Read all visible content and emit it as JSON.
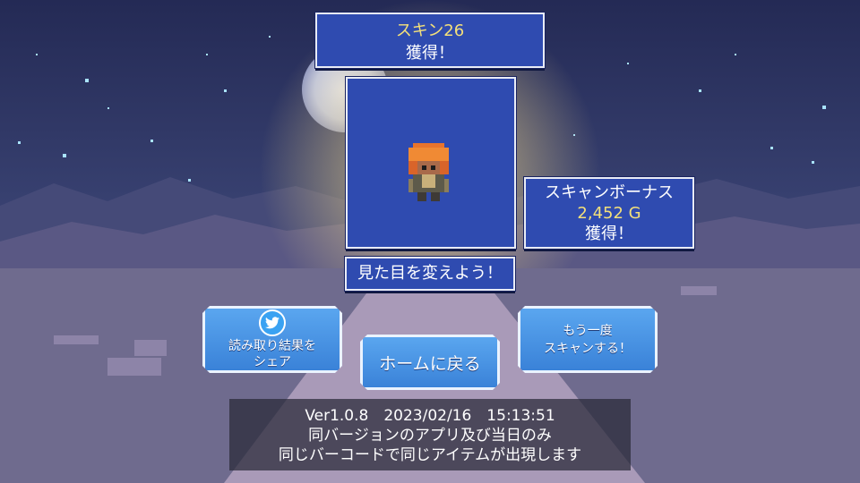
{
  "skin_panel": {
    "name": "スキン26",
    "acquired": "獲得！"
  },
  "bonus_panel": {
    "title": "スキャンボーナス",
    "amount": "2,452 G",
    "acquired": "獲得！"
  },
  "caption": "見た目を変えよう！",
  "buttons": {
    "share": "読み取り結果を\nシェア",
    "home": "ホームに戻る",
    "rescan": "もう一度\nスキャンする！"
  },
  "info": {
    "version_line": "Ver1.0.8　2023/02/16　15:13:51",
    "line2": "同バージョンのアプリ及び当日のみ",
    "line3": "同じバーコードで同じアイテムが出現します"
  },
  "colors": {
    "panel": "#2f4bb0",
    "button": "#4a94e6",
    "gold": "#f4e07a",
    "sky": "#2b3463"
  },
  "icons": {
    "share_icon": "twitter-bird-icon",
    "character": "orange-haired-hero-sprite"
  }
}
